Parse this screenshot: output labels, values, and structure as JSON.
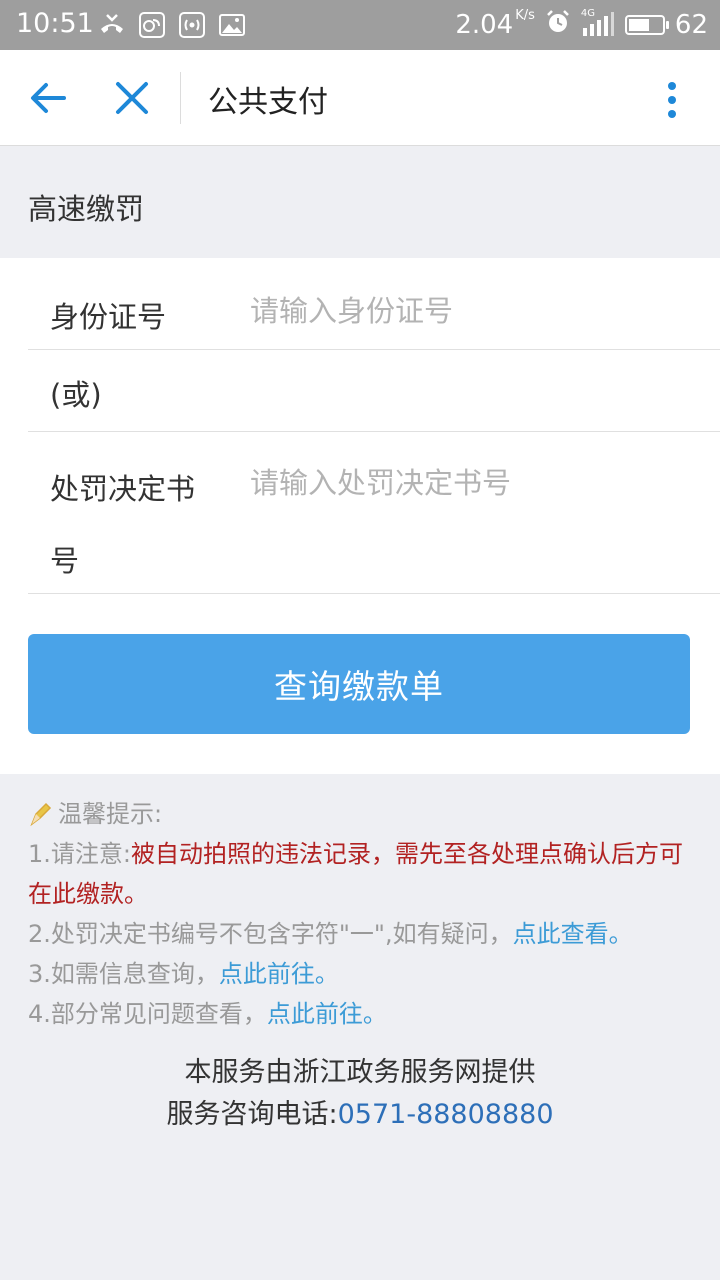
{
  "status_bar": {
    "time": "10:51",
    "speed": "2.04",
    "speed_unit": "K/s",
    "network": "4G",
    "battery": "62",
    "battery_fraction": 0.62
  },
  "nav": {
    "title": "公共支付"
  },
  "section": {
    "title": "高速缴罚"
  },
  "form": {
    "id_label": "身份证号",
    "id_placeholder": "请输入身份证号",
    "or_text": "(或)",
    "decision_label_line1": "处罚决定书",
    "decision_label_line2": "号",
    "decision_placeholder": "请输入处罚决定书号",
    "submit_label": "查询缴款单"
  },
  "tips": {
    "heading": "温馨提示:",
    "item1_prefix": "1.请注意:",
    "item1_warning": "被自动拍照的违法记录，需先至各处理点确认后方可在此缴款。",
    "item2_text": "2.处罚决定书编号不包含字符\"一\",如有疑问，",
    "item2_link": "点此查看。",
    "item3_text": "3.如需信息查询，",
    "item3_link": "点此前往。",
    "item4_text": "4.部分常见问题查看，",
    "item4_link": "点此前往。"
  },
  "footer": {
    "provider": "本服务由浙江政务服务网提供",
    "phone_label": "服务咨询电话:",
    "phone": "0571-88808880"
  },
  "colors": {
    "accent": "#4aa3e8",
    "link": "#3c9bd6",
    "warning": "#b22222"
  }
}
